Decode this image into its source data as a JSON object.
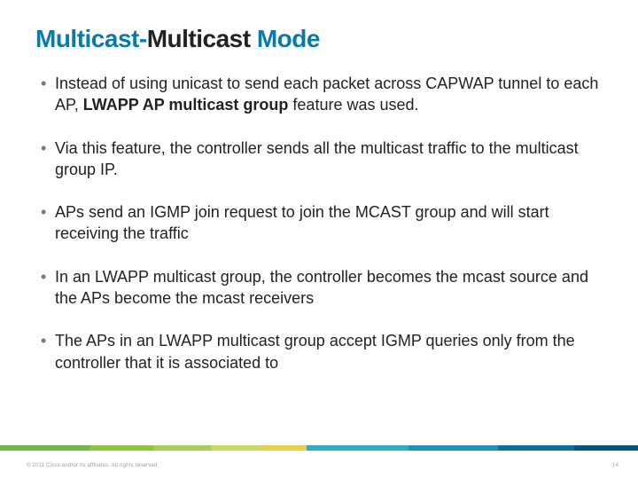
{
  "title": {
    "part1": "Multicast-",
    "accent": "Multicast",
    "part2": " Mode"
  },
  "bullets": [
    {
      "pre": "Instead of using unicast to send each packet across CAPWAP tunnel to each AP, ",
      "bold": "LWAPP AP multicast group",
      "post": " feature was used."
    },
    {
      "pre": "Via this feature, the controller sends all the multicast traffic to the multicast group IP.",
      "bold": "",
      "post": ""
    },
    {
      "pre": "APs send an IGMP join request to join the MCAST group and will start receiving the traffic",
      "bold": "",
      "post": ""
    },
    {
      "pre": "In an LWAPP multicast group, the controller becomes the mcast source and the APs become the mcast receivers",
      "bold": "",
      "post": ""
    },
    {
      "pre": "The APs in an LWAPP multicast group accept IGMP queries only from the controller that it is associated to",
      "bold": "",
      "post": ""
    }
  ],
  "footer": {
    "copyright": "© 2011 Cisco and/or its affiliates. All rights reserved.",
    "page": "14"
  },
  "bar_widths": [
    "14%",
    "10%",
    "9%",
    "8%",
    "7%",
    "16%",
    "14%",
    "12%",
    "10%"
  ]
}
